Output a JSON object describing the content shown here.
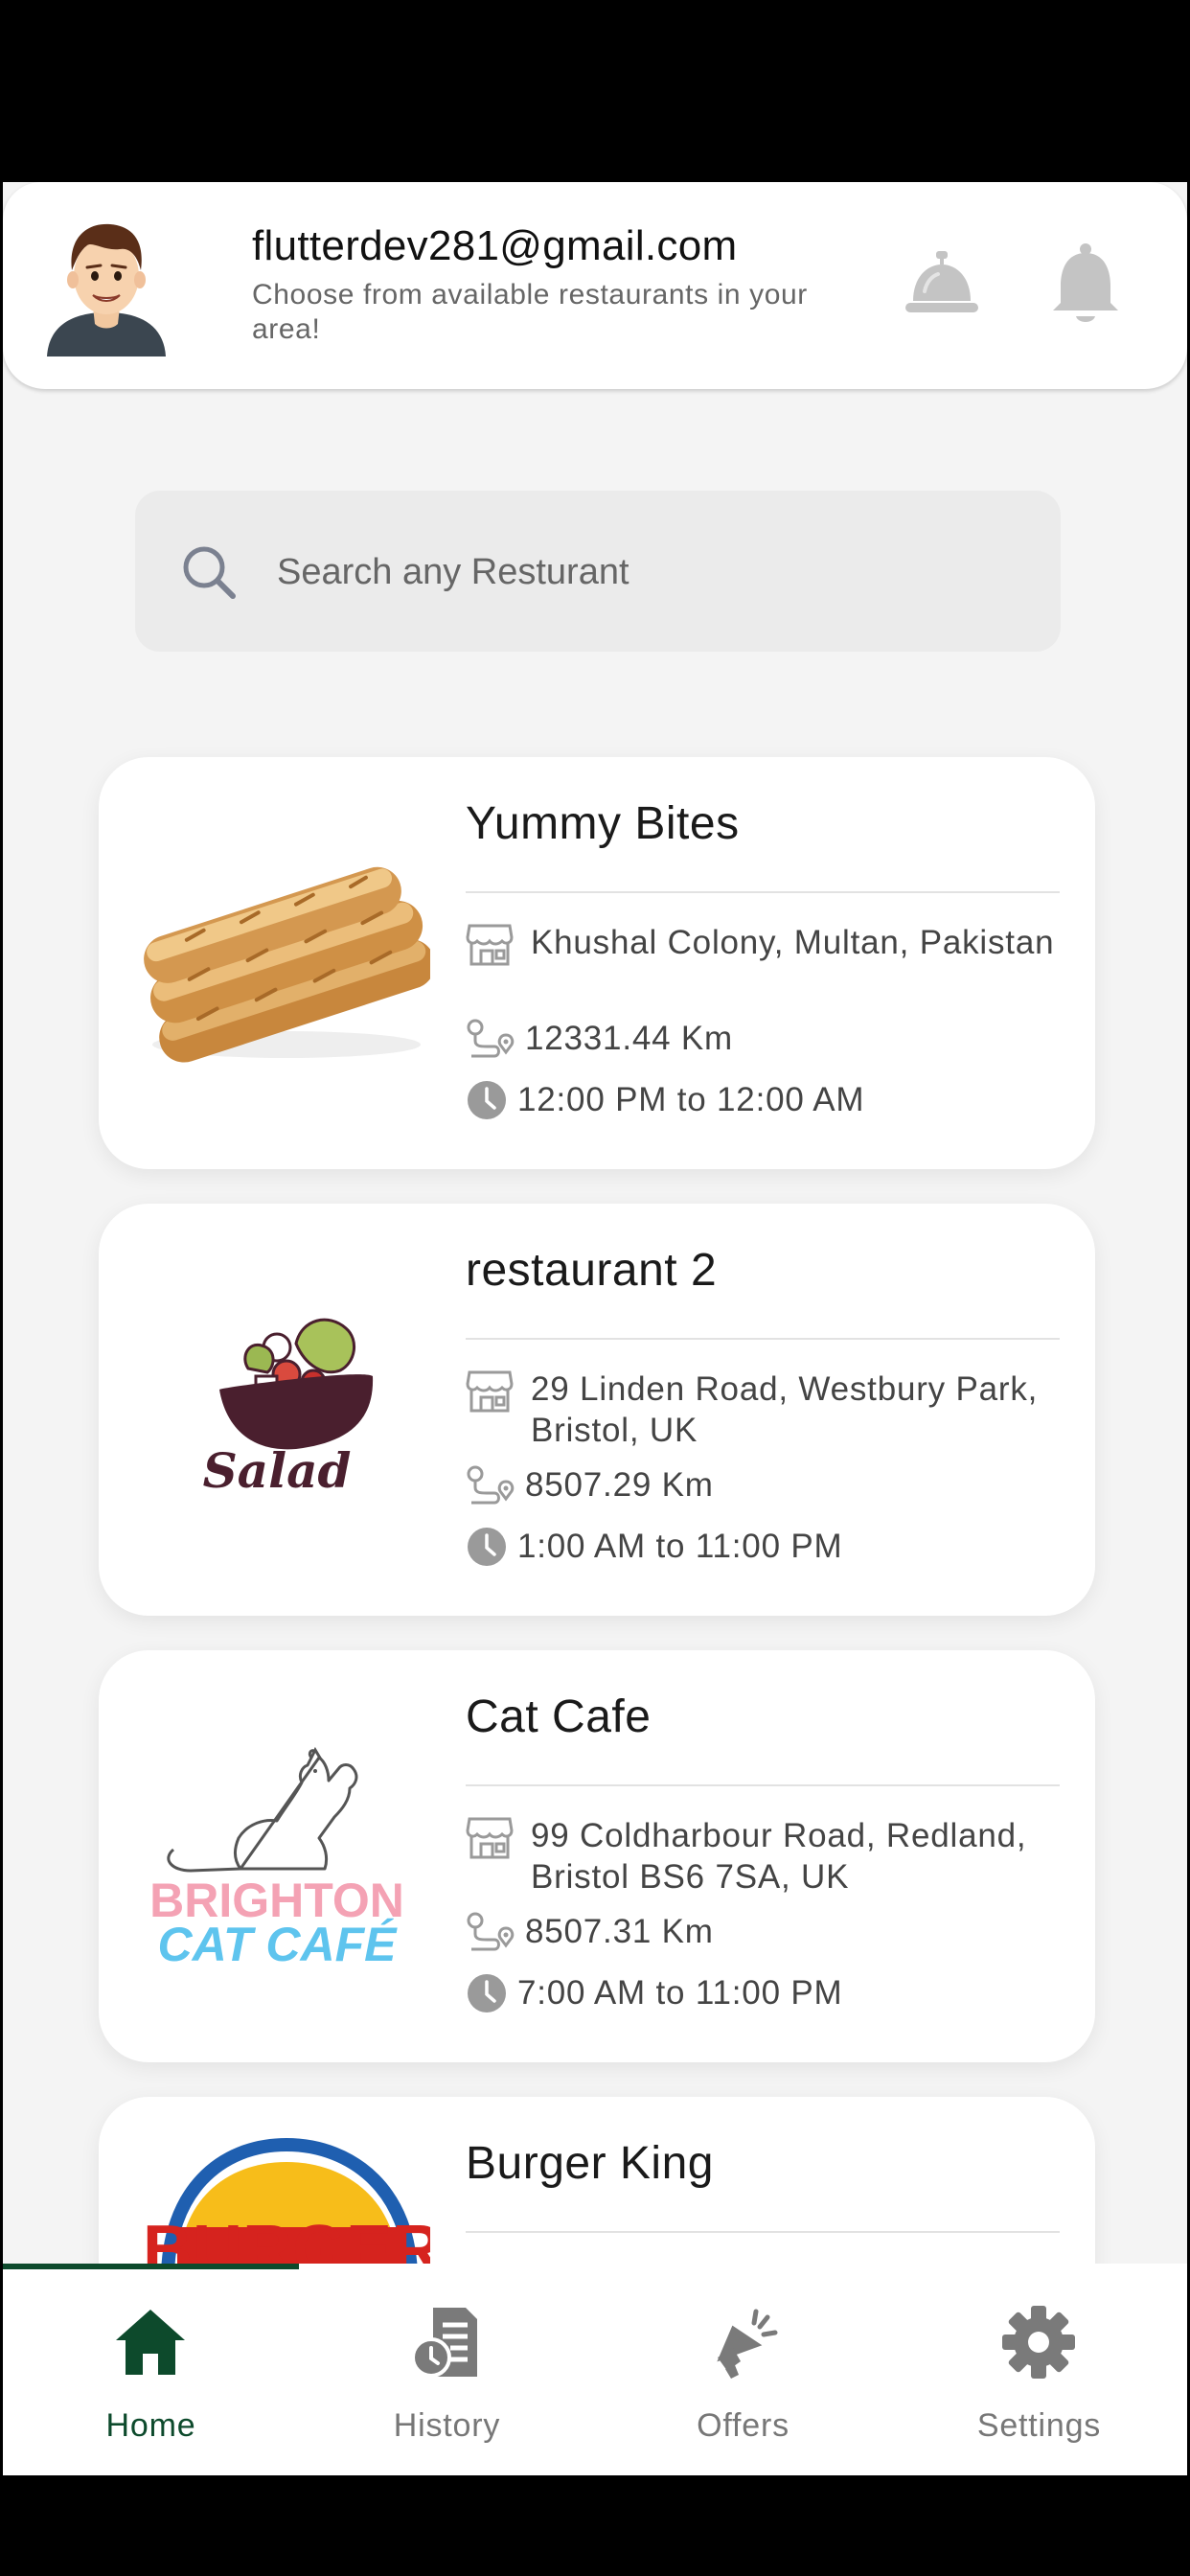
{
  "header": {
    "email": "flutterdev281@gmail.com",
    "subtitle": "Choose from available restaurants in your area!"
  },
  "search": {
    "placeholder": "Search any Resturant"
  },
  "restaurants": [
    {
      "name": "Yummy Bites",
      "address": "Khushal Colony, Multan, Pakistan",
      "distance": "12331.44 Km",
      "hours": "12:00 PM to 12:00 AM",
      "image": "baguettes"
    },
    {
      "name": "restaurant 2",
      "address": "29 Linden Road, Westbury Park, Bristol, UK",
      "distance": "8507.29 Km",
      "hours": "1:00 AM to 11:00 PM",
      "image": "salad-logo"
    },
    {
      "name": "Cat Cafe",
      "address": "99 Coldharbour Road, Redland, Bristol BS6 7SA, UK",
      "distance": "8507.31 Km",
      "hours": "7:00 AM to 11:00 PM",
      "image": "brighton-cat-cafe-logo"
    },
    {
      "name": "Burger King",
      "image": "burger-king-logo"
    }
  ],
  "logos": {
    "salad_text": "Salad",
    "cat_cafe_line1": "BRIGHTON",
    "cat_cafe_line2": "CAT CAFÉ",
    "burger_text": "BURGER"
  },
  "nav": {
    "items": [
      {
        "label": "Home",
        "icon": "home-icon",
        "active": true
      },
      {
        "label": "History",
        "icon": "history-icon",
        "active": false
      },
      {
        "label": "Offers",
        "icon": "offers-icon",
        "active": false
      },
      {
        "label": "Settings",
        "icon": "settings-icon",
        "active": false
      }
    ]
  },
  "colors": {
    "accent": "#0d4a2c",
    "background": "#f4f4f4",
    "card": "#ffffff"
  }
}
